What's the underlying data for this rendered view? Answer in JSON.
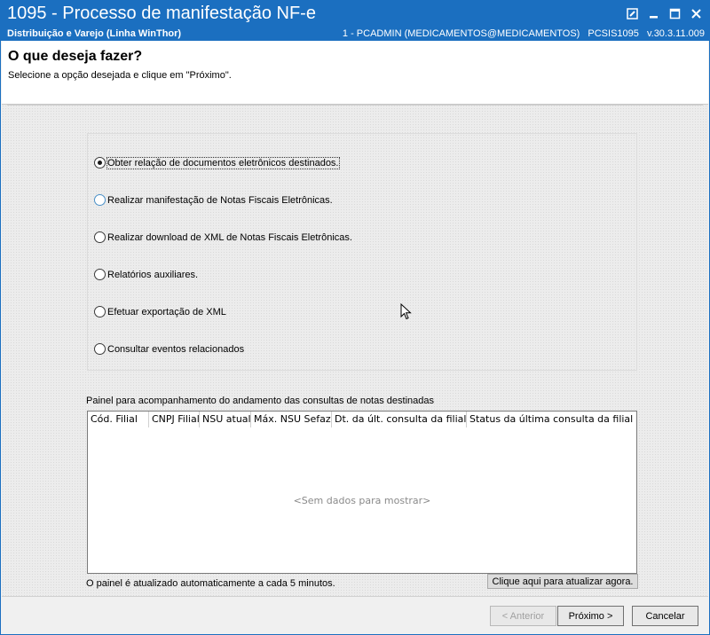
{
  "window": {
    "title": "1095 - Processo de manifestação NF-e",
    "subtitle": "Distribuição e Varejo (Linha WinThor)",
    "user": "1 - PCADMIN (MEDICAMENTOS@MEDICAMENTOS)",
    "program": "PCSIS1095",
    "version": "v.30.3.11.009"
  },
  "header": {
    "heading": "O que deseja fazer?",
    "instruction": "Selecione a opção desejada e clique em \"Próximo\"."
  },
  "options": [
    {
      "label": "Obter relação de documentos eletrônicos destinados.",
      "checked": true
    },
    {
      "label": "Realizar manifestação de Notas Fiscais Eletrônicas.",
      "checked": false
    },
    {
      "label": "Realizar download de XML de Notas Fiscais Eletrônicas.",
      "checked": false
    },
    {
      "label": "Relatórios auxiliares.",
      "checked": false
    },
    {
      "label": "Efetuar exportação de XML",
      "checked": false
    },
    {
      "label": "Consultar eventos relacionados",
      "checked": false
    }
  ],
  "panel": {
    "label": "Painel para acompanhamento do andamento das consultas de notas destinadas",
    "columns": [
      "Cód. Filial",
      "CNPJ Filial",
      "NSU atual",
      "Máx. NSU Sefaz",
      "Dt. da últ. consulta da filial",
      "Status da última consulta da filial"
    ],
    "empty_text": "<Sem dados para mostrar>",
    "note": "O painel é atualizado automaticamente a cada 5 minutos.",
    "refresh_label": "Clique aqui para atualizar agora."
  },
  "buttons": {
    "previous": "< Anterior",
    "next": "Próximo >",
    "cancel": "Cancelar"
  },
  "colors": {
    "titlebar": "#1b6fc0",
    "background": "#f0f0f0"
  }
}
